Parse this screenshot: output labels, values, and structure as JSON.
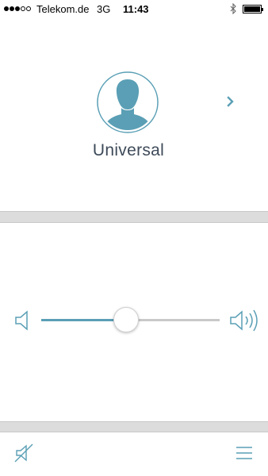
{
  "status_bar": {
    "signal": {
      "filled": 3,
      "total": 5
    },
    "carrier": "Telekom.de",
    "network": "3G",
    "time": "11:43",
    "bluetooth_icon": "bluetooth-icon",
    "battery_icon": "battery-icon",
    "battery_level": 1.0
  },
  "profile": {
    "avatar_icon": "user-avatar-icon",
    "name": "Universal",
    "next_icon": "chevron-right-icon"
  },
  "volume": {
    "low_icon": "speaker-low-icon",
    "high_icon": "speaker-high-icon",
    "level": 0.47
  },
  "bottom_bar": {
    "mute_icon": "speaker-mute-icon",
    "menu_icon": "hamburger-menu-icon"
  },
  "colors": {
    "accent": "#5a9fb5",
    "text": "#3e4a59",
    "separator": "#dcdcdc",
    "track": "#c9c9c9"
  }
}
